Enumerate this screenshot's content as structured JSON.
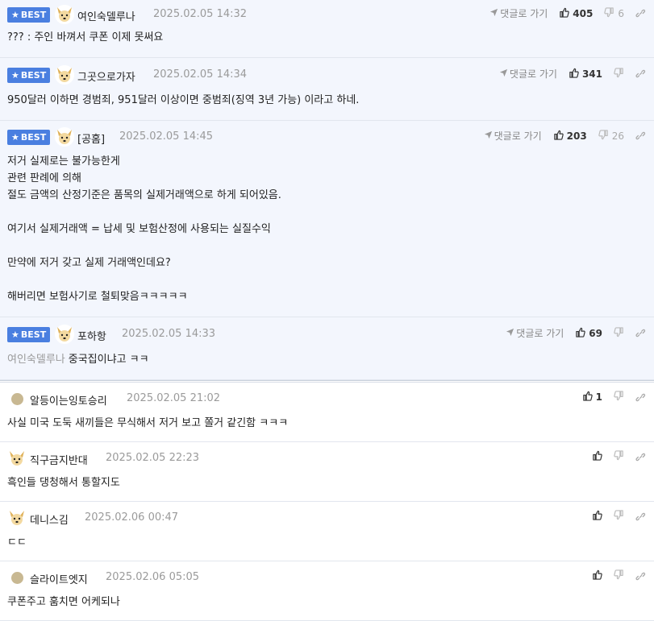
{
  "labels": {
    "best": "BEST",
    "goto_reply": "댓글로 가기"
  },
  "colors": {
    "best_badge": "#4a7fe0",
    "best_bg": "#f3f6fd"
  },
  "best_comments": [
    {
      "nick": "여인숙델루나",
      "date": "2025.02.05 14:32",
      "likes": "405",
      "dislikes": "6",
      "reply_to": "",
      "lines": [
        "??? : 주인 바껴서 쿠폰 이제 못써요"
      ]
    },
    {
      "nick": "그곳으로가자",
      "date": "2025.02.05 14:34",
      "likes": "341",
      "dislikes": "",
      "reply_to": "",
      "lines": [
        "950달러 이하면 경범죄, 951달러 이상이면 중범죄(징역 3년 가능) 이라고 하네."
      ]
    },
    {
      "nick": "[공홈]",
      "date": "2025.02.05 14:45",
      "likes": "203",
      "dislikes": "26",
      "reply_to": "",
      "lines": [
        "저거 실제로는 불가능한게",
        "관련 판례에 의해",
        "절도 금액의 산정기준은 품목의 실제거래액으로 하게 되어있음.",
        "",
        "여기서 실제거래액 = 납세 및 보험산정에 사용되는 실질수익",
        "",
        "만약에 저거 갖고 실제 거래액인데요?",
        "",
        "해버리면 보험사기로 철퇴맞음ㅋㅋㅋㅋㅋ"
      ]
    },
    {
      "nick": "포하항",
      "date": "2025.02.05 14:33",
      "likes": "69",
      "dislikes": "",
      "reply_to": "여인숙델루나",
      "lines": [
        "중국집이냐고 ㅋㅋ"
      ]
    }
  ],
  "comments": [
    {
      "nick": "알등이는잉토승리",
      "date": "2025.02.05 21:02",
      "likes": "1",
      "lines": [
        "사실 미국 도둑 새끼들은 무식해서 저거 보고 쫄거 같긴함 ㅋㅋㅋ"
      ]
    },
    {
      "nick": "직구금지반대",
      "date": "2025.02.05 22:23",
      "likes": "",
      "lines": [
        "흑인들 댕청해서 통할지도"
      ]
    },
    {
      "nick": "데니스김",
      "date": "2025.02.06 00:47",
      "likes": "",
      "lines": [
        "ㄷㄷ"
      ]
    },
    {
      "nick": "슬라이트엣지",
      "date": "2025.02.06 05:05",
      "likes": "",
      "lines": [
        "쿠폰주고 훔치면 어케되나"
      ]
    }
  ]
}
